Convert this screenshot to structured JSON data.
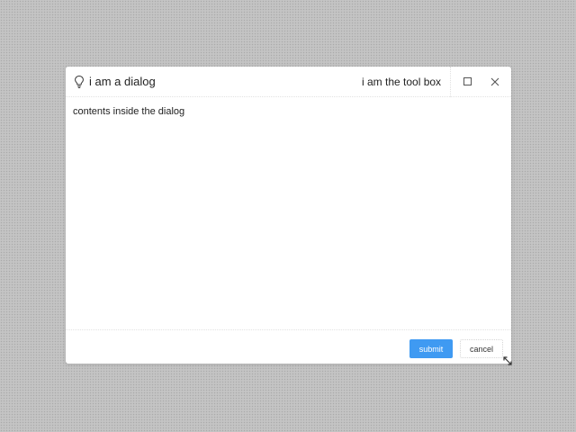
{
  "dialog": {
    "title": "i am a dialog",
    "title_icon": "lightbulb-icon",
    "toolbox_text": "i am the tool box",
    "maximize_icon": "maximize-icon",
    "close_icon": "close-icon",
    "content": "contents inside the dialog",
    "footer": {
      "submit_label": "submit",
      "cancel_label": "cancel"
    },
    "resize_icon": "resize-handle-icon"
  },
  "colors": {
    "backdrop": "#c4c4c4",
    "dialog_bg": "#ffffff",
    "primary": "#3f9af2",
    "text": "#222222"
  }
}
